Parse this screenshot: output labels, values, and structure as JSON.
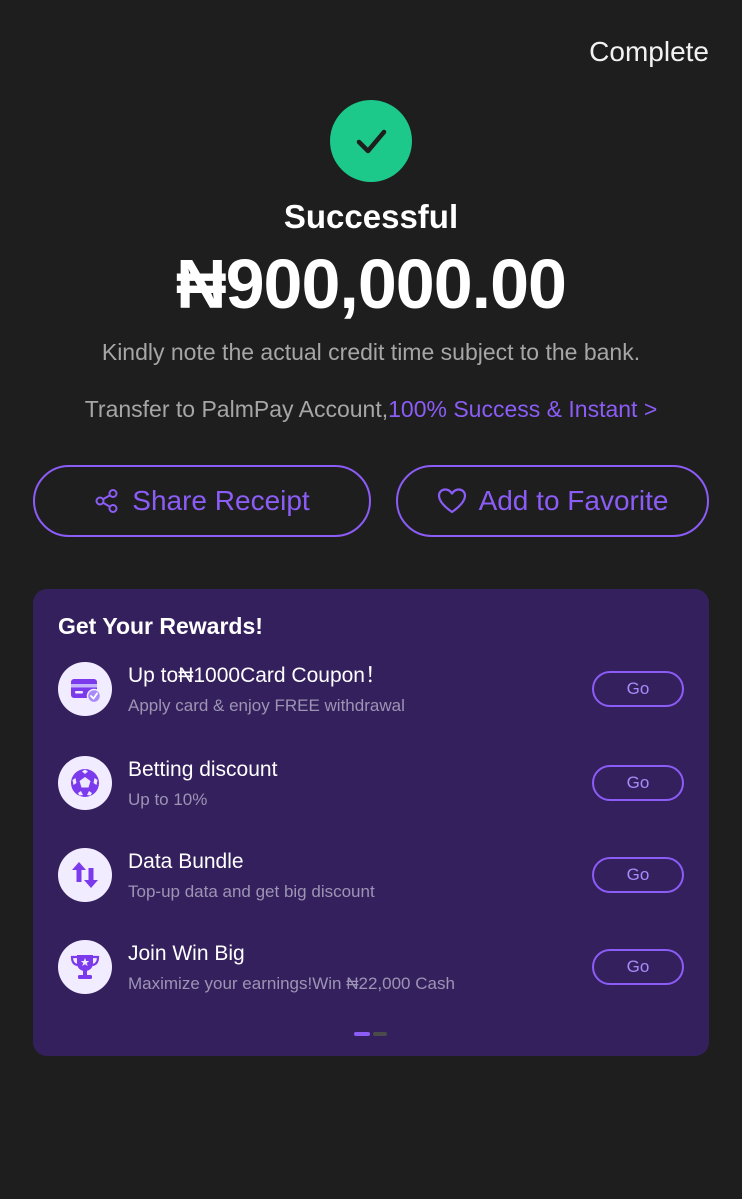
{
  "header": {
    "complete_label": "Complete"
  },
  "status": {
    "title": "Successful",
    "amount": "₦900,000.00",
    "note": "Kindly note the actual credit time subject to the bank.",
    "transfer_prefix": "Transfer to PalmPay Account,",
    "transfer_link": "100% Success & Instant >"
  },
  "actions": {
    "share_label": "Share Receipt",
    "favorite_label": "Add to Favorite"
  },
  "rewards": {
    "title": "Get Your Rewards!",
    "items": [
      {
        "title": "Up to₦1000Card Coupon！",
        "desc": "Apply card & enjoy FREE withdrawal",
        "button": "Go",
        "icon": "card-coupon-icon"
      },
      {
        "title": "Betting discount",
        "desc": "Up to 10%",
        "button": "Go",
        "icon": "soccer-ball-icon"
      },
      {
        "title": "Data Bundle",
        "desc": "Top-up data and get big discount",
        "button": "Go",
        "icon": "data-arrows-icon"
      },
      {
        "title": "Join Win Big",
        "desc": "Maximize your earnings!Win ₦22,000 Cash",
        "button": "Go",
        "icon": "trophy-icon"
      }
    ],
    "pager": {
      "pages": 2,
      "active": 1
    }
  },
  "colors": {
    "background": "#1e1e1e",
    "accent": "#8b5cf6",
    "success": "#1cc98a",
    "card": "#35205e",
    "muted_text": "#a6a6a6"
  }
}
